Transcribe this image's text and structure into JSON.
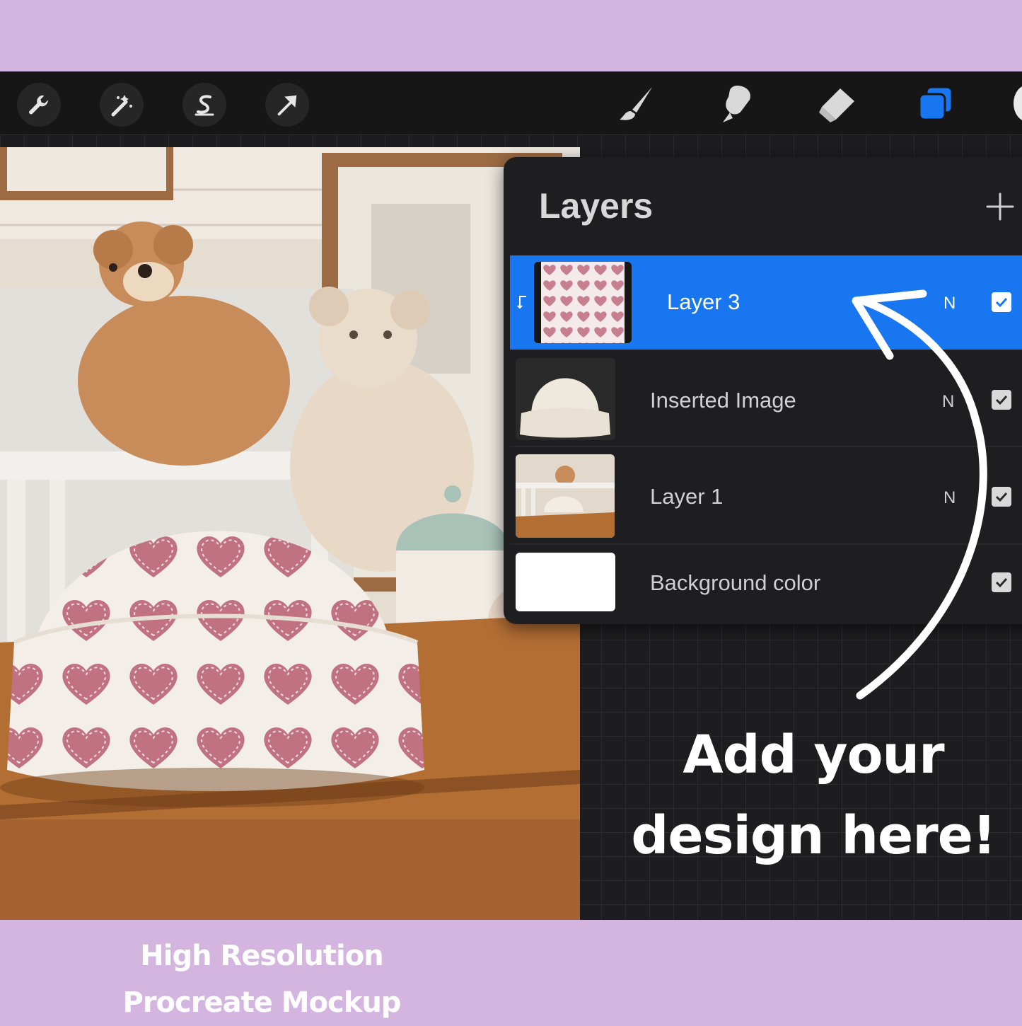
{
  "toolbar": {
    "left_tools": [
      {
        "icon": "wrench-icon",
        "label": "Actions"
      },
      {
        "icon": "magic-wand-icon",
        "label": "Adjustments"
      },
      {
        "icon": "selection-icon",
        "label": "Selection"
      },
      {
        "icon": "transform-arrow-icon",
        "label": "Transform"
      }
    ],
    "right_tools": [
      {
        "icon": "brush-icon",
        "label": "Paint"
      },
      {
        "icon": "smudge-icon",
        "label": "Smudge"
      },
      {
        "icon": "eraser-icon",
        "label": "Erase"
      },
      {
        "icon": "layers-icon",
        "label": "Layers",
        "active": true
      }
    ],
    "accent_color": "#1876f0"
  },
  "layers_panel": {
    "title": "Layers",
    "add_icon": "plus-icon",
    "layers": [
      {
        "name": "Layer 3",
        "mode": "N",
        "visible": true,
        "selected": true,
        "clipping_mask": true,
        "thumbnail": "heart-pattern"
      },
      {
        "name": "Inserted Image",
        "mode": "N",
        "visible": true,
        "selected": false,
        "thumbnail": "white-beanie"
      },
      {
        "name": "Layer 1",
        "mode": "N",
        "visible": true,
        "selected": false,
        "thumbnail": "nursery-scene"
      },
      {
        "name": "Background color",
        "mode": "",
        "visible": true,
        "selected": false,
        "thumbnail": "white-fill"
      }
    ]
  },
  "annotation": {
    "line1": "Add your",
    "line2": "design here!"
  },
  "caption": {
    "line1": "High Resolution",
    "line2": "Procreate Mockup"
  },
  "colors": {
    "band": "#d3b5e0",
    "heart_pink": "#c07283",
    "canvas_bg": "#1d1d1f"
  }
}
